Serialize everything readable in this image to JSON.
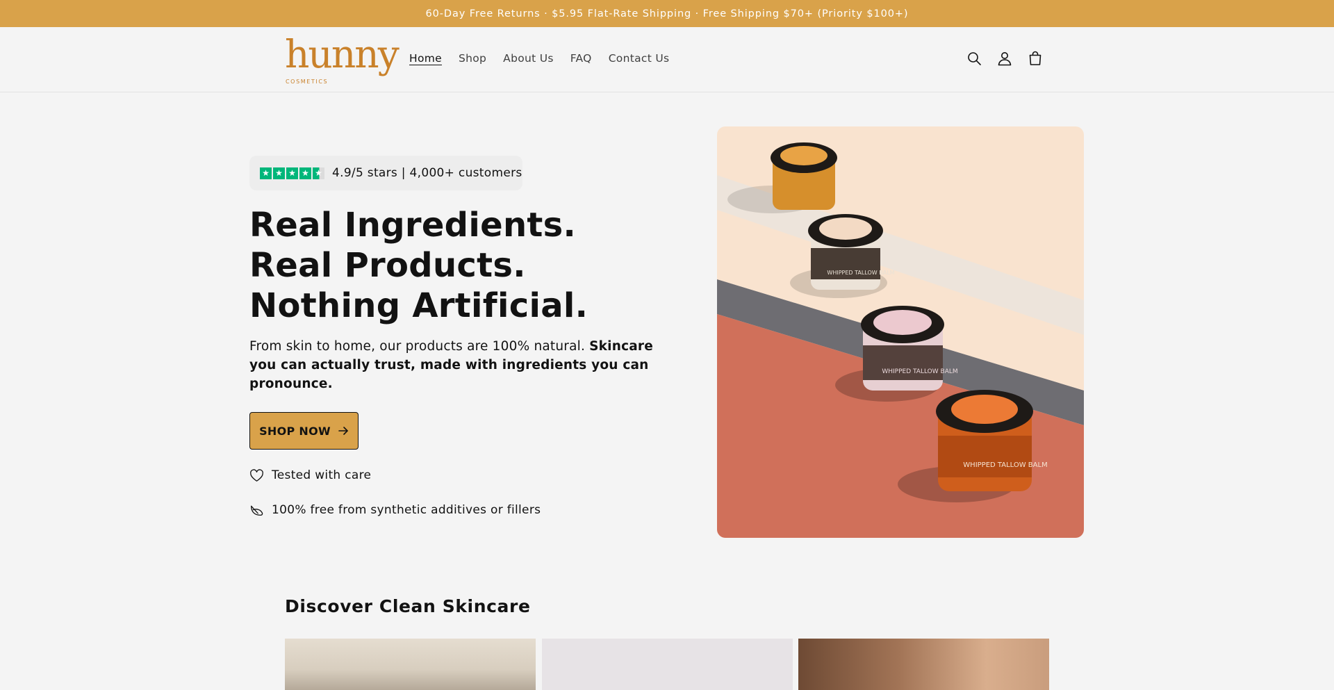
{
  "announcement": "60-Day Free Returns · $5.95 Flat-Rate Shipping · Free Shipping $70+ (Priority $100+)",
  "header": {
    "logo_text": "hunny",
    "logo_subtext": "COSMETICS",
    "nav": [
      {
        "label": "Home",
        "active": true
      },
      {
        "label": "Shop"
      },
      {
        "label": "About Us"
      },
      {
        "label": "FAQ"
      },
      {
        "label": "Contact Us"
      }
    ],
    "icons": [
      "search-icon",
      "account-icon",
      "cart-icon"
    ]
  },
  "hero": {
    "rating": {
      "stars": 4.5,
      "text": "4.9/5 stars | 4,000+ customers",
      "star_color": "#00b67a"
    },
    "title": "Real Ingredients. Real Products. Nothing Artificial.",
    "description_plain": "From skin to home, our products are 100% natural. ",
    "description_bold": "Skincare you can actually trust, made with ingredients you can pronounce.",
    "cta_label": "SHOP NOW",
    "features": [
      {
        "icon": "heart-icon",
        "text": "Tested with care"
      },
      {
        "icon": "leaf-icon",
        "text": "100% free from synthetic additives or fillers"
      }
    ],
    "image": {
      "jars": [
        {
          "label": "WHIPPED TALLOW BALM"
        },
        {
          "label": "WHIPPED TALLOW BALM"
        },
        {
          "label": "WHIPPED TALLOW BALM"
        }
      ]
    }
  },
  "collection": {
    "title": "Discover Clean Skincare"
  },
  "colors": {
    "brand": "#d9a24a",
    "logo": "#c9812a",
    "text": "#121212",
    "background": "#f4f4f4"
  }
}
